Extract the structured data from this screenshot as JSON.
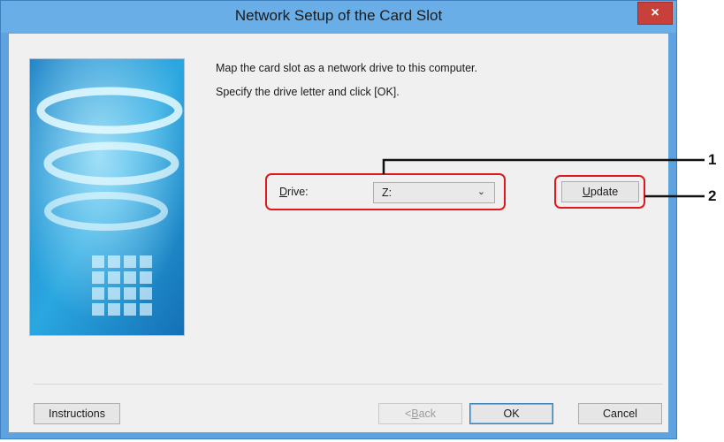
{
  "window": {
    "title": "Network Setup of the Card Slot",
    "close_glyph": "×"
  },
  "description": {
    "line1": "Map the card slot as a network drive to this computer.",
    "line2": "Specify the drive letter and click [OK]."
  },
  "drive": {
    "label_mnemonic": "D",
    "label_rest": "rive:",
    "selected": "Z:",
    "chevron": "⌄"
  },
  "buttons": {
    "update_mnemonic": "U",
    "update_rest": "pdate",
    "instructions": "Instructions",
    "back_prefix": "<",
    "back_mnemonic": "B",
    "back_rest": "ack",
    "ok": "OK",
    "cancel": "Cancel"
  },
  "callouts": {
    "one": "1",
    "two": "2"
  },
  "colors": {
    "highlight_box": "#e0181b",
    "titlebar": "#6aaee8",
    "close_button": "#c7403a"
  }
}
